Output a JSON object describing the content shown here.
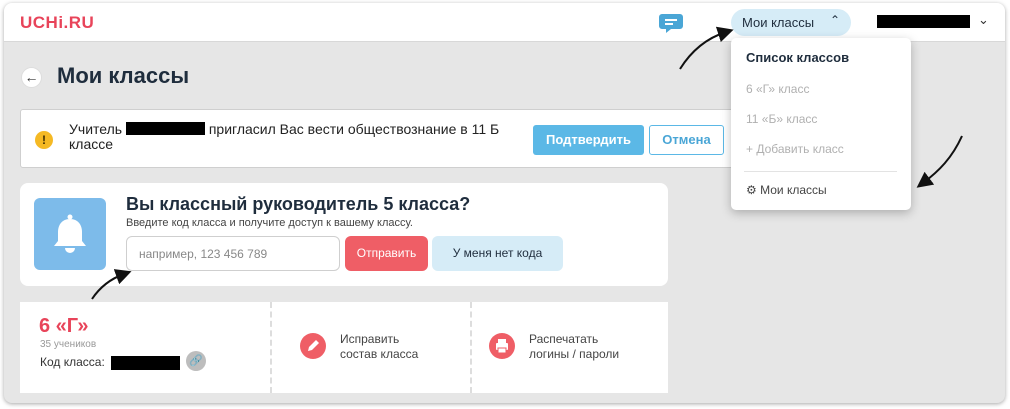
{
  "header": {
    "logo": "UCHi.RU",
    "my_classes_label": "Мои классы",
    "my_classes_chevron": "⌃",
    "user_chevron": "⌄"
  },
  "dropdown": {
    "heading": "Список классов",
    "items": [
      "6 «Г» класс",
      "11 «Б» класс"
    ],
    "add_class": "+ Добавить класс",
    "my_classes_icon": "⚙",
    "my_classes": "Мои классы"
  },
  "page": {
    "back_icon": "←",
    "title": "Мои классы"
  },
  "invite": {
    "warning_icon": "!",
    "text_before": "Учитель",
    "text_after": "пригласил Вас вести обществознание в 11 Б классе",
    "confirm_label": "Подтвердить",
    "cancel_label": "Отмена"
  },
  "homeroom": {
    "title": "Вы классный руководитель 5 класса?",
    "subtitle": "Введите код класса и получите доступ к вашему классу.",
    "input_placeholder": "например, 123 456 789",
    "send_label": "Отправить",
    "no_code_label": "У меня нет кода"
  },
  "class_card": {
    "name": "6 «Г»",
    "students": "35 учеников",
    "code_label": "Код класса:",
    "link_icon": "🔗",
    "actions": [
      {
        "icon": "pencil-icon",
        "line1": "Исправить",
        "line2": "состав класса"
      },
      {
        "icon": "printer-icon",
        "line1": "Распечатать",
        "line2": "логины / пароли"
      }
    ]
  },
  "colors": {
    "brand_red": "#e8445a",
    "accent_blue": "#5bb8e6",
    "light_blue": "#d6ecf7",
    "button_red": "#ef5e66"
  }
}
